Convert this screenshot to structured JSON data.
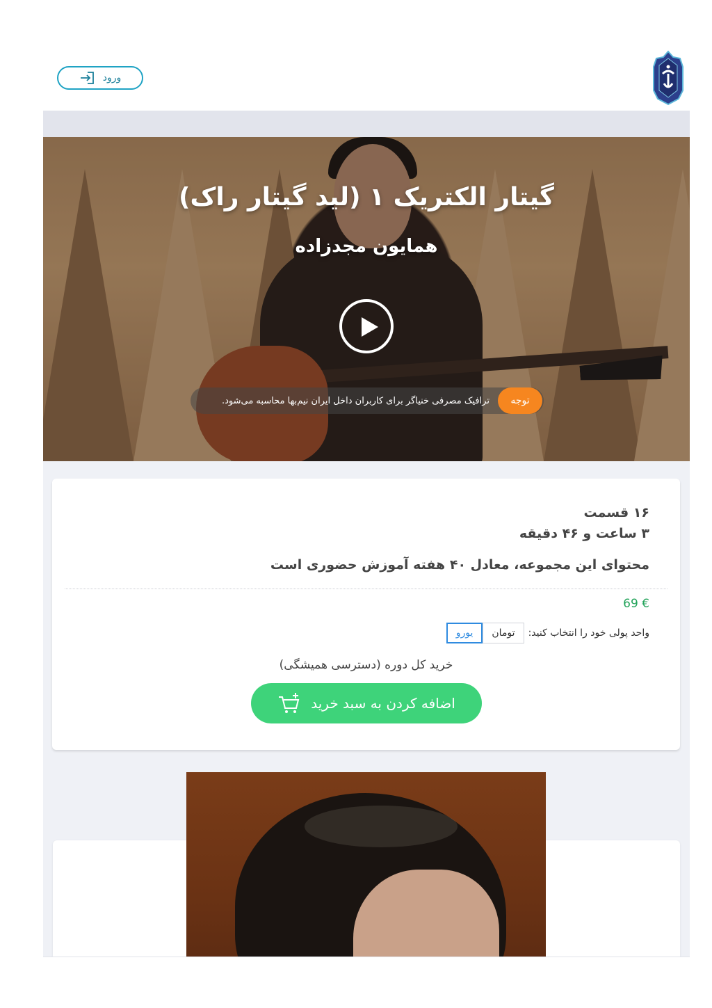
{
  "header": {
    "login_label": "ورود"
  },
  "hero": {
    "title": "گیتار الکتریک ۱ (لید گیتار راک)",
    "instructor": "همایون مجدزاده",
    "notice_badge": "توجه",
    "notice_text": "ترافیک مصرفی خنیاگر برای کاربران داخل ایران نیم‌بها محاسبه می‌شود."
  },
  "course": {
    "episodes": "۱۶ قسمت",
    "duration": "۳ ساعت و ۴۶ دقیقه",
    "equivalent": "محتوای این مجموعه،  معادل ۴۰ هفته آموزش حضوری است",
    "price": "69 €",
    "currency_prompt": "واحد پولی خود را انتخاب کنید:",
    "currency_options": [
      "تومان",
      "یورو"
    ],
    "currency_selected": "یورو",
    "buy_label": "خرید کل دوره (دسترسی همیشگی)",
    "cart_button": "اضافه کردن به سبد خرید"
  },
  "colors": {
    "accent_teal": "#1fa3c4",
    "notice_orange": "#f6861f",
    "price_green": "#23a35a",
    "cart_green": "#3ed37a",
    "selected_blue": "#2f8be0"
  },
  "icons": {
    "login": "login-arrow-icon",
    "play": "play-icon",
    "cart": "cart-plus-icon",
    "logo": "khaniagar-logo"
  }
}
